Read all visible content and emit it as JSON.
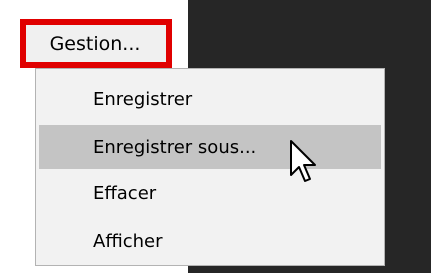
{
  "gestion_button": {
    "label": "Gestion..."
  },
  "menu": {
    "items": [
      {
        "label": "Enregistrer",
        "highlighted": false
      },
      {
        "label": "Enregistrer sous...",
        "highlighted": true
      },
      {
        "label": "Effacer",
        "highlighted": false
      },
      {
        "label": "Afficher",
        "highlighted": false
      }
    ]
  },
  "cursor": {
    "icon": "arrow-pointer-icon"
  },
  "colors": {
    "highlight_border": "#e00000",
    "dark_background": "#262626",
    "menu_background": "#f2f2f2",
    "hover_background": "#c4c4c4"
  }
}
